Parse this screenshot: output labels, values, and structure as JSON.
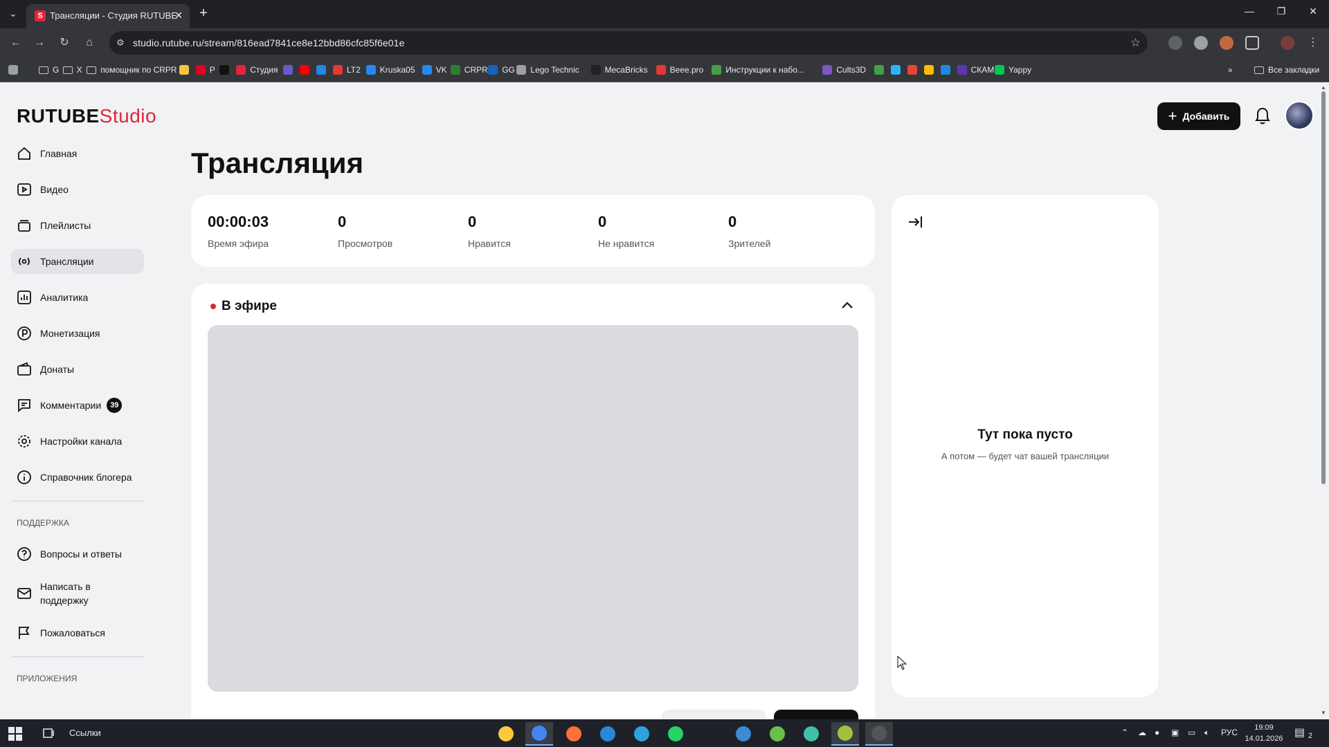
{
  "browser": {
    "tab_title": "Трансляции - Студия RUTUBE",
    "tab_favicon": "S",
    "url": "studio.rutube.ru/stream/816ead7841ce8e12bbd86cfc85f6e01e",
    "bookmarks": [
      {
        "label": "G",
        "icon": "folder-icon",
        "color": ""
      },
      {
        "label": "X",
        "icon": "folder-icon",
        "color": ""
      },
      {
        "label": "помощник по CRPR",
        "icon": "folder-icon",
        "color": ""
      },
      {
        "label": "",
        "icon": "hand-icon",
        "color": "#f4c542"
      },
      {
        "label": "P",
        "icon": "pinterest-icon",
        "color": "#e60023"
      },
      {
        "label": "",
        "icon": "r-icon",
        "color": "#111111"
      },
      {
        "label": "Студия",
        "icon": "rutube-studio-icon",
        "color": "#e5243b"
      },
      {
        "label": "",
        "icon": "app-icon",
        "color": "#6a5acd"
      },
      {
        "label": "",
        "icon": "youtube-icon",
        "color": "#ff0000"
      },
      {
        "label": "",
        "icon": "frame-icon",
        "color": "#1e88e5"
      },
      {
        "label": "LT2",
        "icon": "lt2-icon",
        "color": "#e53935"
      },
      {
        "label": "Kruska05",
        "icon": "vk-icon",
        "color": "#2787f5"
      },
      {
        "label": "VK",
        "icon": "vk-icon",
        "color": "#2787f5"
      },
      {
        "label": "CRPR",
        "icon": "crpr-icon",
        "color": "#2e7d32"
      },
      {
        "label": "GG",
        "icon": "gg-icon",
        "color": "#1565c0"
      },
      {
        "label": "Lego Technic",
        "icon": "tools-icon",
        "color": "#9e9e9e"
      },
      {
        "label": "MecaBricks",
        "icon": "mecabricks-icon",
        "color": "#222222"
      },
      {
        "label": "Beee.pro",
        "icon": "beee-icon",
        "color": "#e53935"
      },
      {
        "label": "Инструкции к набо...",
        "icon": "diamond-icon",
        "color": "#43a047"
      },
      {
        "label": "Cults3D",
        "icon": "cults-icon",
        "color": "#7e57c2"
      },
      {
        "label": "",
        "icon": "fl-icon",
        "color": "#43a047"
      },
      {
        "label": "",
        "icon": "game-icon",
        "color": "#29b6f6"
      },
      {
        "label": "",
        "icon": "gmail-icon",
        "color": "#ea4335"
      },
      {
        "label": "",
        "icon": "drive-icon",
        "color": "#fbbc04"
      },
      {
        "label": "",
        "icon": "tl-icon",
        "color": "#1e88e5"
      },
      {
        "label": "СКАМ",
        "icon": "scam-icon",
        "color": "#5e35b1"
      },
      {
        "label": "Yappy",
        "icon": "yappy-icon",
        "color": "#00c853"
      }
    ],
    "all_bookmarks_label": "Все закладки"
  },
  "app": {
    "logo_main": "RUTUBE",
    "logo_accent": "Studio",
    "add_button_label": "Добавить",
    "page_title": "Трансляция"
  },
  "sidebar": {
    "items": [
      {
        "label": "Главная",
        "icon": "home-icon",
        "active": false
      },
      {
        "label": "Видео",
        "icon": "video-icon",
        "active": false
      },
      {
        "label": "Плейлисты",
        "icon": "playlist-icon",
        "active": false
      },
      {
        "label": "Трансляции",
        "icon": "broadcast-icon",
        "active": true
      },
      {
        "label": "Аналитика",
        "icon": "analytics-icon",
        "active": false
      },
      {
        "label": "Монетизация",
        "icon": "ruble-icon",
        "active": false
      },
      {
        "label": "Донаты",
        "icon": "wallet-icon",
        "active": false
      },
      {
        "label": "Комментарии",
        "icon": "comment-icon",
        "active": false,
        "badge": "39"
      },
      {
        "label": "Настройки канала",
        "icon": "gear-icon",
        "active": false
      },
      {
        "label": "Справочник блогера",
        "icon": "info-icon",
        "active": false
      }
    ],
    "support_heading": "ПОДДЕРЖКА",
    "support_items": [
      {
        "label": "Вопросы и ответы",
        "icon": "question-icon"
      },
      {
        "label": "Написать в поддержку",
        "icon": "mail-icon"
      },
      {
        "label": "Пожаловаться",
        "icon": "flag-icon"
      }
    ],
    "apps_heading": "ПРИЛОЖЕНИЯ"
  },
  "stats": [
    {
      "value": "00:00:03",
      "label": "Время эфира"
    },
    {
      "value": "0",
      "label": "Просмотров"
    },
    {
      "value": "0",
      "label": "Нравится"
    },
    {
      "value": "0",
      "label": "Не нравится"
    },
    {
      "value": "0",
      "label": "Зрителей"
    }
  ],
  "live": {
    "status_label": "В эфире",
    "status_color": "#e5243b"
  },
  "chat": {
    "empty_title": "Тут пока пусто",
    "empty_subtitle": "А потом — будет чат вашей трансляции"
  },
  "taskbar": {
    "links_label": "Ссылки",
    "language": "РУС",
    "time": "19:09",
    "date": "14.01.2026",
    "notification_count": "2",
    "apps": [
      {
        "icon": "file-explorer-icon",
        "color": "#f9c93c",
        "active": false
      },
      {
        "icon": "chrome-icon",
        "color": "#4285f4",
        "active": true
      },
      {
        "icon": "firefox-icon",
        "color": "#ff7139",
        "active": false
      },
      {
        "icon": "store-icon",
        "color": "#2b88d8",
        "active": false
      },
      {
        "icon": "telegram-icon",
        "color": "#2aa3e0",
        "active": false
      },
      {
        "icon": "whatsapp-icon",
        "color": "#25d366",
        "active": false
      },
      {
        "icon": "app-c-icon",
        "color": "#3d8bd1",
        "active": false
      },
      {
        "icon": "arrow-app-icon",
        "color": "#6abf4b",
        "active": false
      },
      {
        "icon": "shield-app-icon",
        "color": "#3ec1a6",
        "active": false
      },
      {
        "icon": "game-app-icon",
        "color": "#a0c33b",
        "active": true
      },
      {
        "icon": "obs-icon",
        "color": "#555555",
        "active": true
      }
    ]
  },
  "colors": {
    "accent": "#e5243b",
    "page_bg": "#f1f2f4",
    "card_bg": "#ffffff",
    "player_bg": "#dadbdf",
    "dark_button": "#111111"
  }
}
